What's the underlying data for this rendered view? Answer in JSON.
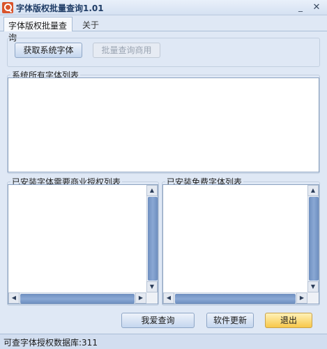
{
  "window": {
    "title": "字体版权批量查询1.01",
    "minimize_label": "_",
    "close_label": "✕"
  },
  "tabs": [
    {
      "label": "字体版权批量查询"
    },
    {
      "label": "关于"
    }
  ],
  "toolbar": {
    "get_fonts_label": "获取系统字体",
    "batch_query_label": "批量查询商用"
  },
  "groups": {
    "all_fonts_title": "系统所有字体列表",
    "commercial_title": "已安装字体需要商业授权列表",
    "free_title": "已安装免费字体列表"
  },
  "scroll": {
    "up": "▲",
    "down": "▼",
    "left": "◀",
    "right": "▶"
  },
  "actions": {
    "query_label": "我爱查询",
    "update_label": "软件更新",
    "exit_label": "退出"
  },
  "status": {
    "text": "可查字体授权数据库:311"
  },
  "colors": {
    "accent": "#6e8fc0",
    "exit_button": "#f7c84a"
  }
}
